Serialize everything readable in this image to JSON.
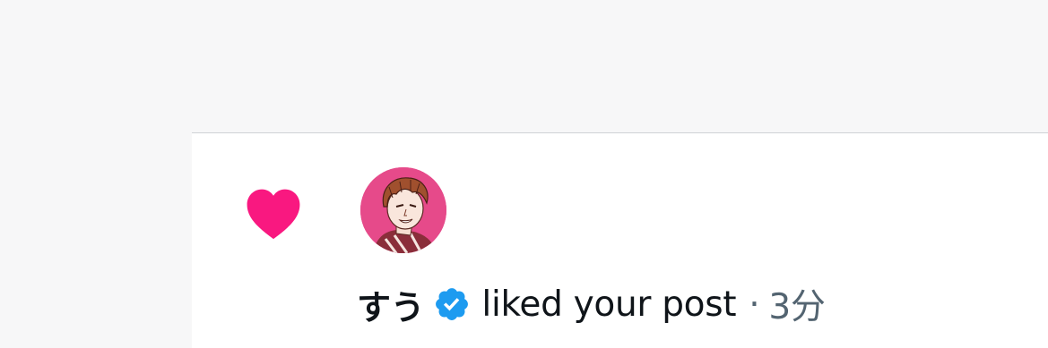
{
  "notification": {
    "type_icon": "heart-icon",
    "user_name": "すう",
    "verified_icon": "verified-badge-icon",
    "action": "liked your post",
    "separator": "·",
    "time": "3分"
  },
  "colors": {
    "heart": "#f91880",
    "verified": "#1d9bf0",
    "avatar_bg": "#e64a8a",
    "text_primary": "#0f1419",
    "text_secondary": "#536471",
    "card_bg": "#ffffff",
    "page_bg": "#f7f7f8",
    "divider": "#cfd2d6"
  }
}
